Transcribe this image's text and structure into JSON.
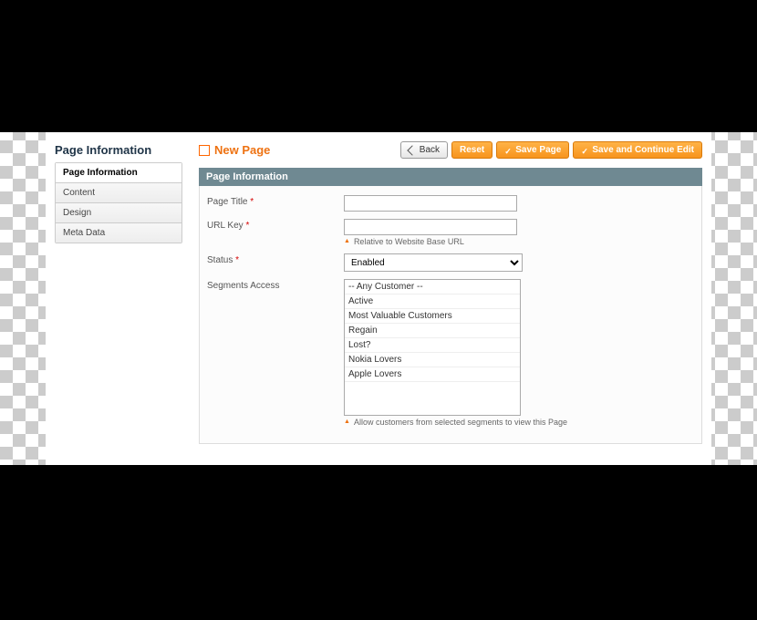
{
  "sidebar": {
    "title": "Page Information",
    "tabs": [
      {
        "label": "Page Information",
        "active": true
      },
      {
        "label": "Content",
        "active": false
      },
      {
        "label": "Design",
        "active": false
      },
      {
        "label": "Meta Data",
        "active": false
      }
    ]
  },
  "header": {
    "title": "New Page"
  },
  "buttons": {
    "back": "Back",
    "reset": "Reset",
    "save": "Save Page",
    "save_continue": "Save and Continue Edit"
  },
  "section": {
    "title": "Page Information"
  },
  "fields": {
    "page_title": {
      "label": "Page Title",
      "required": true,
      "value": ""
    },
    "url_key": {
      "label": "URL Key",
      "required": true,
      "value": "",
      "hint": "Relative to Website Base URL"
    },
    "status": {
      "label": "Status",
      "required": true,
      "value": "Enabled"
    },
    "segments": {
      "label": "Segments Access",
      "required": false,
      "options": [
        "-- Any Customer --",
        "Active",
        "Most Valuable Customers",
        "Regain",
        "Lost?",
        "Nokia Lovers",
        "Apple Lovers"
      ],
      "hint": "Allow customers from selected segments to view this Page"
    }
  }
}
